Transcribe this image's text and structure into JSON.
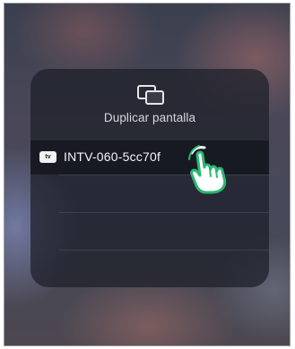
{
  "screen_mirroring": {
    "title": "Duplicar pantalla",
    "mirror_icon": "screen-mirroring-icon",
    "devices": [
      {
        "badge": "tv",
        "badge_icon": "apple-tv-icon",
        "name": "INTV-060-5cc70f"
      }
    ]
  },
  "overlay": {
    "pointer_icon": "tap-hand-icon",
    "pointer_color": "#2bb673"
  }
}
